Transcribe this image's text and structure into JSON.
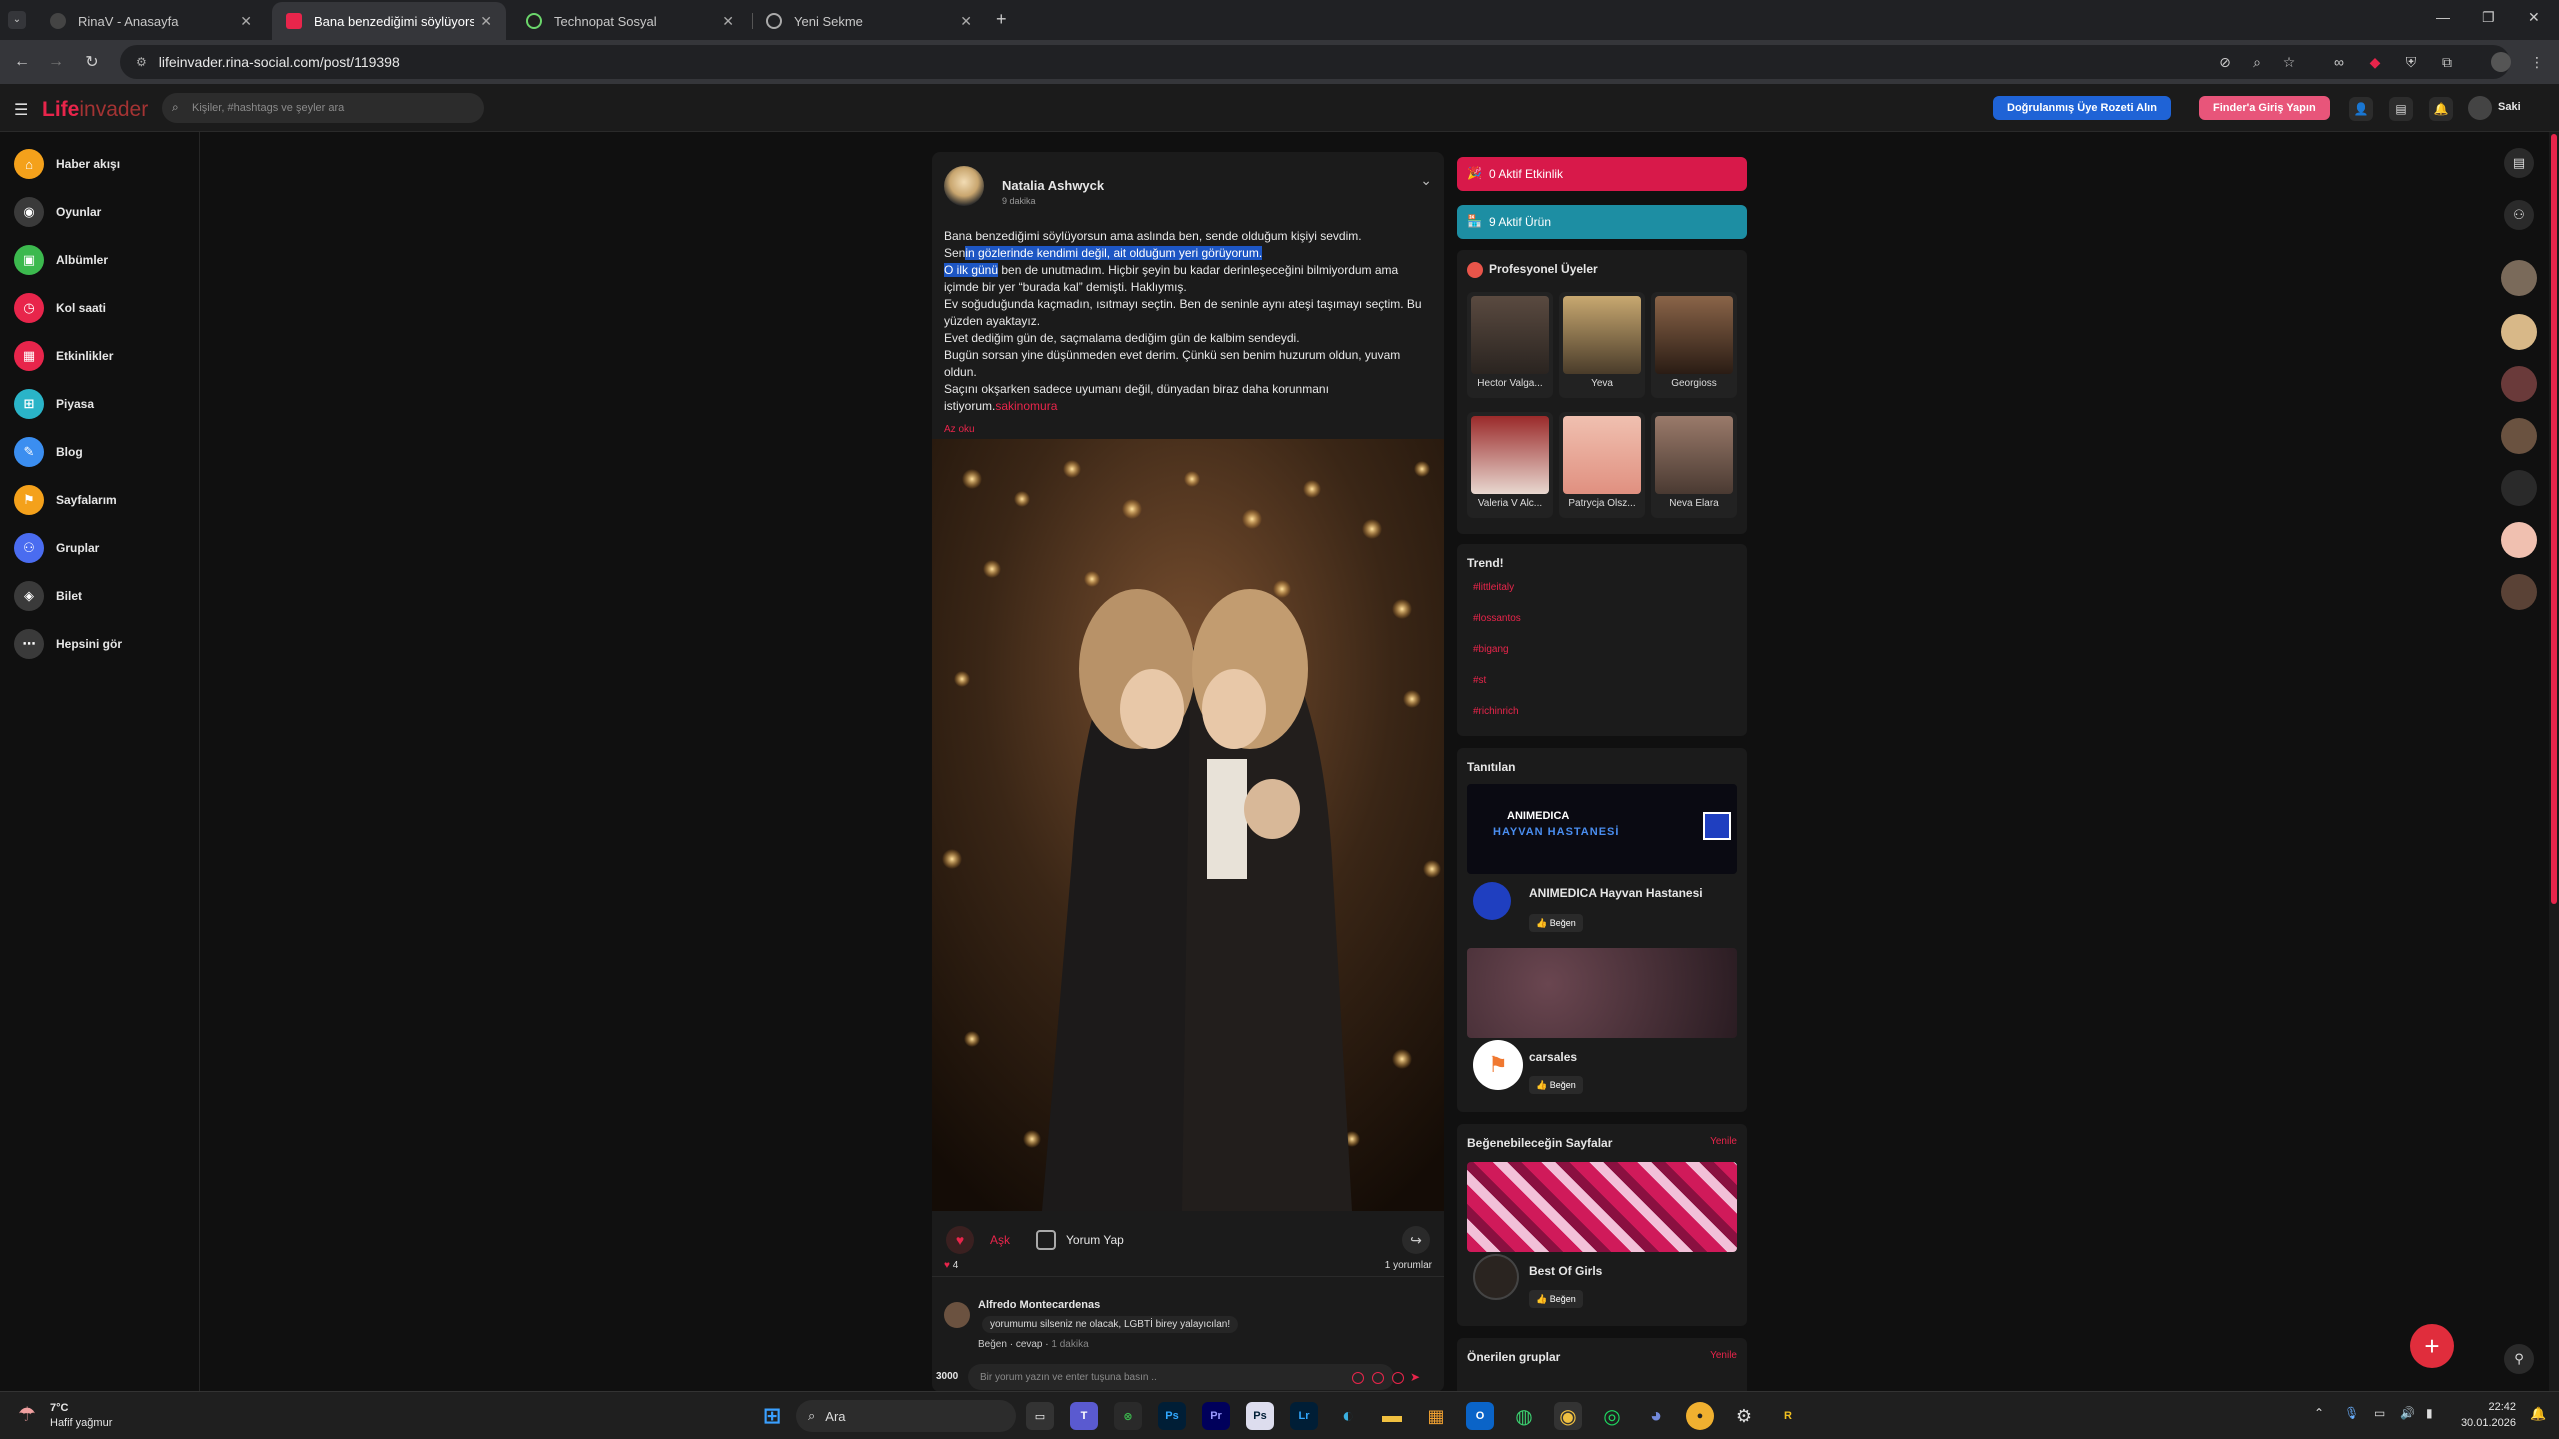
{
  "browser": {
    "tabs": [
      {
        "title": "RinaV - Anasayfa",
        "active": false
      },
      {
        "title": "Bana benzediğimi söylüyorsun",
        "active": true
      },
      {
        "title": "Technopat Sosyal",
        "active": false
      },
      {
        "title": "Yeni Sekme",
        "active": false
      }
    ],
    "url": "lifeinvader.rina-social.com/post/119398"
  },
  "site": {
    "logo_main": "Life",
    "logo_sub": "invader",
    "search_placeholder": "Kişiler, #hashtags ve şeyler ara",
    "verified_button": "Doğrulanmış Üye Rozeti Alın",
    "finder_button": "Finder'a Giriş Yapın",
    "user_name": "Saki"
  },
  "leftnav": [
    {
      "label": "Haber akışı",
      "icon": "home-icon",
      "color": "#f4a11b"
    },
    {
      "label": "Oyunlar",
      "icon": "gamepad-icon",
      "color": "#3a3a3a"
    },
    {
      "label": "Albümler",
      "icon": "album-icon",
      "color": "#3cb94e"
    },
    {
      "label": "Kol saati",
      "icon": "watch-icon",
      "color": "#e8254b"
    },
    {
      "label": "Etkinlikler",
      "icon": "calendar-icon",
      "color": "#e8254b"
    },
    {
      "label": "Piyasa",
      "icon": "market-icon",
      "color": "#2ab4c8"
    },
    {
      "label": "Blog",
      "icon": "blog-icon",
      "color": "#3b8ef0"
    },
    {
      "label": "Sayfalarım",
      "icon": "flag-icon",
      "color": "#f4a11b"
    },
    {
      "label": "Gruplar",
      "icon": "group-icon",
      "color": "#4a6cf0"
    },
    {
      "label": "Bilet",
      "icon": "ticket-icon",
      "color": "#3a3a3a"
    },
    {
      "label": "Hepsini gör",
      "icon": "more-icon",
      "color": "#3a3a3a"
    }
  ],
  "post": {
    "author": "Natalia Ashwyck",
    "time": "9 dakika",
    "text_line1": "Bana benzediğimi söylüyorsun ama aslında ben, sende olduğum kişiyi sevdim.",
    "text_line2_pre": "Sen",
    "text_line2_hl": "in gözlerinde kendimi değil, ait olduğum yeri görüyorum.",
    "text_line3_hl": "O ilk günü",
    "text_line3_rest": " ben de unutmadım. Hiçbir şeyin bu kadar derinleşeceğini bilmiyordum ama içimde bir yer “burada kal” demişti. Haklıymış.",
    "text_line4": "Ev soğuduğunda kaçmadın, ısıtmayı seçtin. Ben de seninle aynı ateşi taşımayı seçtim. Bu yüzden ayaktayız.",
    "text_line5": "Evet dediğim gün de, saçmalama dediğim gün de kalbim sendeydi.",
    "text_line6": "Bugün sorsan yine düşünmeden evet derim. Çünkü sen benim huzurum oldun, yuvam oldun.",
    "text_line7": "Saçını okşarken sadece uyumanı değil, dünyadan biraz daha korunmanı istiyorum.",
    "text_tag": "sakinomura",
    "read_less": "Az oku",
    "like_label": "Aşk",
    "comment_button": "Yorum Yap",
    "reaction_count": "4",
    "comment_count": "1 yorumlar",
    "comment": {
      "author": "Alfredo Montecardenas",
      "text": "yorumumu silseniz ne olacak, LGBTİ birey yalayıcılan!",
      "like": "Beğen",
      "reply": "cevap",
      "time": "1 dakika"
    },
    "char_count": "3000",
    "comment_placeholder": "Bir yorum yazın ve enter tuşuna basın .."
  },
  "right": {
    "active_events": "0 Aktif Etkinlik",
    "active_products": "9 Aktif Ürün",
    "pro_title": "Profesyonel Üyeler",
    "pro_users": [
      {
        "name": "Hector Valga...",
        "color": "#4a4038"
      },
      {
        "name": "Yeva",
        "color": "#b59a6a"
      },
      {
        "name": "Georgioss",
        "color": "#6a4e3a"
      },
      {
        "name": "Valeria V Alc...",
        "color": "#7a2a2a"
      },
      {
        "name": "Patrycja Olsz...",
        "color": "#e8b8a8"
      },
      {
        "name": "Neva Elara",
        "color": "#8a6a5a"
      }
    ],
    "trend_title": "Trend!",
    "trends": [
      "#littleitaly",
      "#lossantos",
      "#bigang",
      "#st",
      "#richinrich"
    ],
    "promoted_title": "Tanıtılan",
    "banner_text": "ANIMEDICA",
    "banner_sub": "HAYVAN HASTANESİ",
    "promoted": [
      {
        "name": "ANIMEDICA Hayvan Hastanesi",
        "like": "Beğen"
      },
      {
        "name": "carsales",
        "like": "Beğen"
      }
    ],
    "pages_title": "Beğenebileceğin Sayfalar",
    "refresh": "Yenile",
    "suggested_page": {
      "name": "Best Of Girls",
      "like": "Beğen"
    },
    "groups_title": "Önerilen gruplar",
    "groups_refresh": "Yenile"
  },
  "taskbar": {
    "weather_temp": "7°C",
    "weather_desc": "Hafif yağmur",
    "search_label": "Ara",
    "time": "22:42",
    "date": "30.01.2026"
  }
}
